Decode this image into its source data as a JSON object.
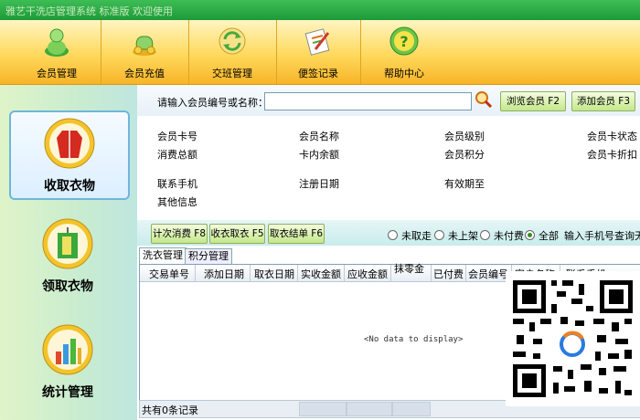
{
  "window": {
    "title": "雅艺干洗店管理系统 标准版 欢迎使用"
  },
  "toolbar": [
    {
      "label": "会员管理",
      "icon": "member-icon"
    },
    {
      "label": "会员充值",
      "icon": "money-bag-icon"
    },
    {
      "label": "交班管理",
      "icon": "refresh-arrows-icon"
    },
    {
      "label": "便签记录",
      "icon": "notepad-icon"
    },
    {
      "label": "帮助中心",
      "icon": "help-icon"
    }
  ],
  "sidebar": [
    {
      "label": "收取衣物",
      "icon": "coat-icon",
      "active": true
    },
    {
      "label": "领取衣物",
      "icon": "garment-bag-icon",
      "active": false
    },
    {
      "label": "统计管理",
      "icon": "chart-icon",
      "active": false
    }
  ],
  "search": {
    "label": "请输入会员编号或名称：",
    "value": "",
    "browse_button": "浏览会员 F2",
    "add_button": "添加会员 F3"
  },
  "info_labels": {
    "card_no": "会员卡号",
    "name": "会员名称",
    "level": "会员级别",
    "card_status": "会员卡状态",
    "total_spend": "消费总额",
    "balance": "卡内余额",
    "points": "会员积分",
    "discount": "会员卡折扣",
    "phone": "联系手机",
    "reg_date": "注册日期",
    "expiry": "有效期至",
    "other": "其他信息"
  },
  "actions": {
    "count_spend": "计次消费 F8",
    "collect": "收衣取衣 F5",
    "checkout": "取衣结单 F6"
  },
  "filters": {
    "options": [
      {
        "label": "未取走",
        "selected": false
      },
      {
        "label": "未上架",
        "selected": false
      },
      {
        "label": "未付费",
        "selected": false
      },
      {
        "label": "全部",
        "selected": true
      }
    ],
    "phone_query": "输入手机号查询无"
  },
  "tabs": [
    {
      "label": "洗衣管理",
      "active": true
    },
    {
      "label": "积分管理",
      "active": false
    }
  ],
  "grid": {
    "columns": [
      "交易单号",
      "添加日期",
      "取衣日期",
      "实收金额",
      "应收金额",
      "抹零金",
      "已付费",
      "会员编号",
      "客户名称",
      "联系手机"
    ],
    "empty_text": "<No data to display>"
  },
  "status": {
    "record_count": "共有0条记录"
  }
}
